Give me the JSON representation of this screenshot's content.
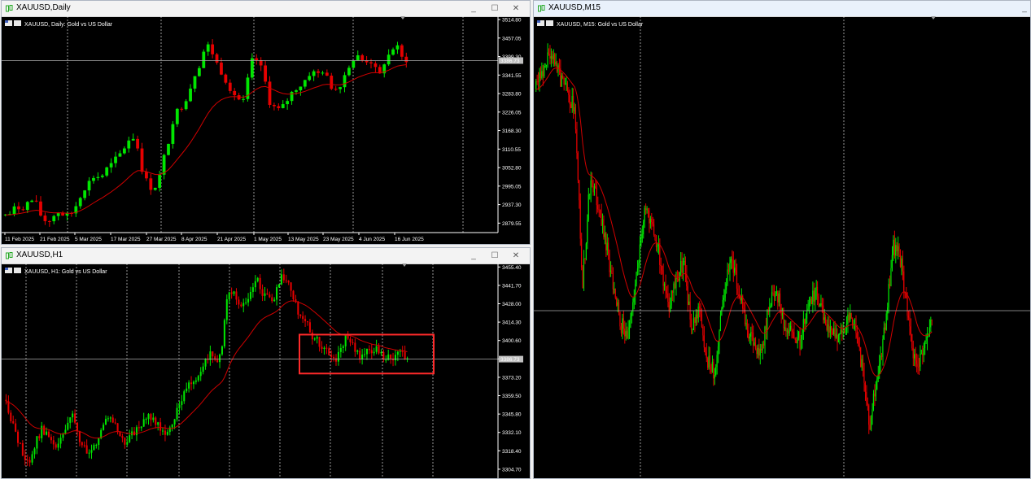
{
  "windows": {
    "daily": {
      "title": "XAUUSD,Daily",
      "chart_label": "XAUUSD, Daily:  Gold vs US Dollar",
      "current_price": "3386.73",
      "price_ticks": [
        "3514.80",
        "3457.05",
        "3399.30",
        "3341.55",
        "3283.80",
        "3226.05",
        "3168.30",
        "3110.55",
        "3052.80",
        "2995.05",
        "2937.30",
        "2879.55"
      ],
      "date_ticks": [
        "11 Feb 2025",
        "21 Feb 2025",
        "5 Mar 2025",
        "17 Mar 2025",
        "27 Mar 2025",
        "8 Apr 2025",
        "21 Apr 2025",
        "1 May 2025",
        "13 May 2025",
        "23 May 2025",
        "4 Jun 2025",
        "16 Jun 2025"
      ]
    },
    "h1": {
      "title": "XAUUSD,H1",
      "chart_label": "XAUUSD, H1:  Gold vs US Dollar",
      "current_price": "3386.73",
      "price_ticks": [
        "3455.40",
        "3441.70",
        "3428.00",
        "3414.30",
        "3400.60",
        "3386.90",
        "3373.20",
        "3359.50",
        "3345.80",
        "3332.10",
        "3318.40",
        "3304.70"
      ]
    },
    "m15": {
      "title": "XAUUSD,M15",
      "chart_label": "XAUUSD, M15:  Gold vs US Dollar"
    }
  },
  "window_buttons": {
    "minimize": "_",
    "maximize": "☐",
    "close": "✕"
  },
  "colors": {
    "bull": "#00e600",
    "bear": "#e60000",
    "ma": "#d00000",
    "grid": "#ffffff",
    "axis_text": "#ffffff",
    "highlight_box": "#ff2a2a"
  },
  "chart_data": [
    {
      "type": "candlestick",
      "title": "XAUUSD, Daily:  Gold vs US Dollar",
      "x": [
        "11 Feb 2025",
        "21 Feb 2025",
        "5 Mar 2025",
        "17 Mar 2025",
        "27 Mar 2025",
        "8 Apr 2025",
        "21 Apr 2025",
        "1 May 2025",
        "13 May 2025",
        "23 May 2025",
        "4 Jun 2025",
        "16 Jun 2025"
      ],
      "ylim": [
        2850,
        3525
      ],
      "close_path": [
        2905,
        2910,
        2930,
        2925,
        2940,
        2950,
        2935,
        2890,
        2885,
        2900,
        2915,
        2905,
        2900,
        2920,
        2960,
        2990,
        3010,
        3030,
        3020,
        3045,
        3060,
        3080,
        3100,
        3130,
        3155,
        3120,
        3040,
        3000,
        2985,
        3010,
        3080,
        3140,
        3220,
        3235,
        3260,
        3300,
        3350,
        3380,
        3440,
        3420,
        3380,
        3350,
        3320,
        3290,
        3270,
        3250,
        3330,
        3400,
        3380,
        3340,
        3260,
        3240,
        3230,
        3250,
        3280,
        3300,
        3310,
        3330,
        3355,
        3340,
        3360,
        3330,
        3300,
        3300,
        3330,
        3370,
        3390,
        3400,
        3380,
        3395,
        3360,
        3340,
        3390,
        3410,
        3440,
        3395,
        3390
      ],
      "moving_average": true,
      "current_price": 3386.73
    },
    {
      "type": "candlestick",
      "title": "XAUUSD, H1:  Gold vs US Dollar",
      "ylim": [
        3298,
        3458
      ],
      "close_path": [
        3355,
        3340,
        3325,
        3315,
        3310,
        3325,
        3335,
        3330,
        3320,
        3325,
        3335,
        3345,
        3330,
        3320,
        3315,
        3325,
        3335,
        3345,
        3340,
        3330,
        3325,
        3330,
        3335,
        3340,
        3345,
        3340,
        3335,
        3330,
        3340,
        3355,
        3365,
        3370,
        3375,
        3385,
        3390,
        3385,
        3390,
        3440,
        3435,
        3425,
        3430,
        3440,
        3445,
        3435,
        3430,
        3435,
        3450,
        3445,
        3430,
        3420,
        3415,
        3405,
        3400,
        3395,
        3390,
        3385,
        3395,
        3405,
        3395,
        3388,
        3392,
        3390,
        3395,
        3386,
        3390,
        3388,
        3392,
        3386
      ],
      "moving_average": true,
      "current_price": 3386.73,
      "highlight": {
        "price_range": [
          3376,
          3405
        ]
      }
    },
    {
      "type": "candlestick",
      "title": "XAUUSD, M15:  Gold vs US Dollar",
      "moving_average": true
    }
  ]
}
